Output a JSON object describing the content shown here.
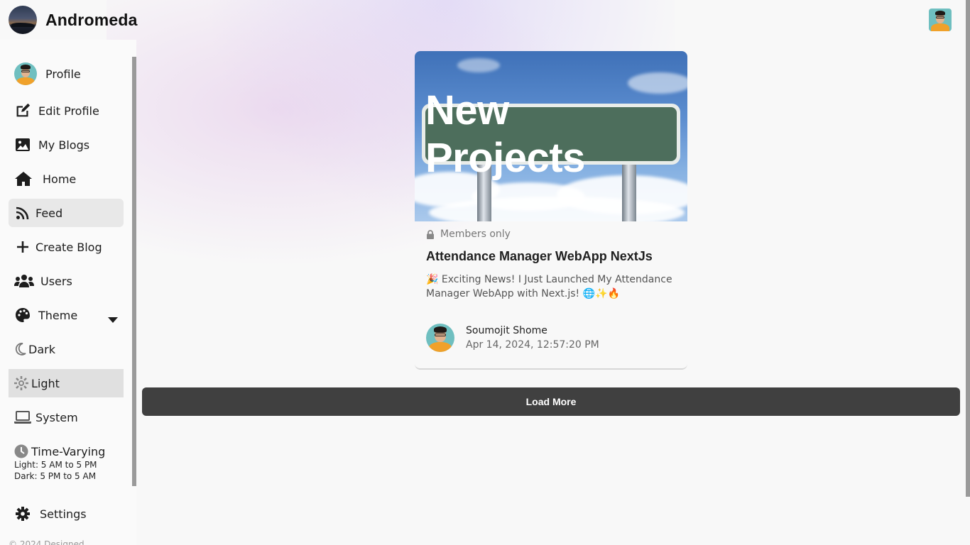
{
  "app": {
    "name": "Andromeda"
  },
  "sidebar": {
    "items": [
      {
        "label": "Profile",
        "icon": "avatar"
      },
      {
        "label": "Edit Profile",
        "icon": "edit-icon"
      },
      {
        "label": "My Blogs",
        "icon": "image-icon"
      },
      {
        "label": "Home",
        "icon": "home-icon"
      },
      {
        "label": "Feed",
        "icon": "rss-icon",
        "active": true
      },
      {
        "label": "Create Blog",
        "icon": "plus-icon"
      },
      {
        "label": "Users",
        "icon": "users-icon"
      },
      {
        "label": "Theme",
        "icon": "palette-icon"
      },
      {
        "label": "Dark",
        "icon": "moon-icon"
      },
      {
        "label": "Light",
        "icon": "sun-icon",
        "selected": true
      },
      {
        "label": "System",
        "icon": "laptop-icon"
      },
      {
        "label": "Time-Varying",
        "icon": "clock-icon"
      },
      {
        "label": "Settings",
        "icon": "gear-icon"
      }
    ],
    "time_varying": {
      "light": "Light: 5 AM to 5 PM",
      "dark": "Dark: 5 PM to 5 AM"
    },
    "footer": "© 2024 Designed"
  },
  "post": {
    "image_text": "New Projects",
    "access": "Members only",
    "title": "Attendance Manager WebApp NextJs",
    "excerpt": "🎉 Exciting News! I Just Launched My Attendance Manager WebApp with Next.js! 🌐✨🔥",
    "author": "Soumojit Shome",
    "date": "Apr 14, 2024, 12:57:20 PM"
  },
  "actions": {
    "load_more": "Load More"
  },
  "colors": {
    "button_bg": "#404040",
    "active_bg": "#e8e8e8",
    "page_bg": "#f8f8f8"
  }
}
